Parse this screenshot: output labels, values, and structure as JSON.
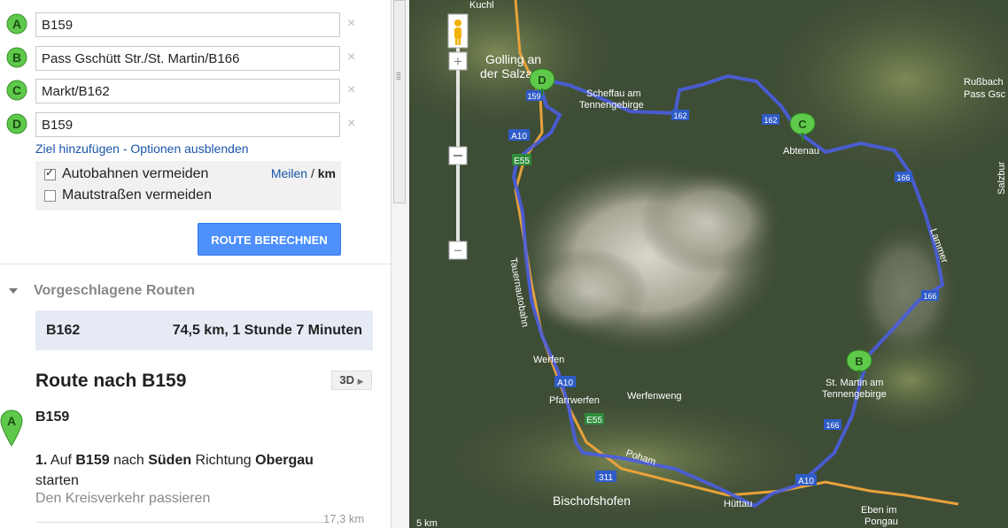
{
  "waypoints": [
    {
      "marker": "A",
      "value": "B159",
      "color": "#5ec94a"
    },
    {
      "marker": "B",
      "value": "Pass Gschütt Str./St. Martin/B166",
      "color": "#5ec94a"
    },
    {
      "marker": "C",
      "value": "Markt/B162",
      "color": "#5ec94a"
    },
    {
      "marker": "D",
      "value": "B159",
      "color": "#5ec94a"
    }
  ],
  "remove_glyph": "×",
  "links": {
    "add_destination": "Ziel hinzufügen",
    "separator": " - ",
    "hide_options": "Optionen ausblenden"
  },
  "options": {
    "avoid_highways": {
      "label": "Autobahnen vermeiden",
      "checked": true
    },
    "avoid_tolls": {
      "label": "Mautstraßen vermeiden",
      "checked": false
    },
    "units": {
      "miles": "Meilen",
      "separator": " / ",
      "km": "km"
    }
  },
  "route_button": "ROUTE BERECHNEN",
  "suggested": {
    "heading": "Vorgeschlagene Routen",
    "route_name": "B162",
    "route_info": "74,5 km, 1 Stunde 7 Minuten"
  },
  "directions": {
    "title": "Route nach B159",
    "btn_3d": "3D",
    "start_marker": "A",
    "start_label": "B159",
    "step_number": "1.",
    "step_parts": [
      "Auf ",
      "B159",
      " nach ",
      "Süden",
      " Richtung ",
      "Obergau",
      " starten"
    ],
    "step_note": "Den Kreisverkehr passieren",
    "step_distance": "17,3 km"
  },
  "map": {
    "labels": {
      "kuchl": "Kuchl",
      "golling_1": "Golling an",
      "golling_2": "der Salzach",
      "scheffau_1": "Scheffau am",
      "scheffau_2": "Tennengebirge",
      "abtenau": "Abtenau",
      "russbach_1": "Rußbach",
      "russbach_2": "Pass Gsc",
      "salzburg": "Salzbur",
      "werfen": "Werfen",
      "werfenweng": "Werfenweng",
      "pfarrwerfen": "Pfarrwerfen",
      "stmartin_1": "St. Martin am",
      "stmartin_2": "Tennengebirge",
      "bischofshofen": "Bischofshofen",
      "huttau": "Hüttau",
      "eben_1": "Eben im",
      "eben_2": "Pongau",
      "poham": "Poham",
      "tauernautobahn": "Tauernautobahn",
      "lammer": "Lammer"
    },
    "shields": {
      "a10": "A10",
      "e55": "E55",
      "b159": "159",
      "b162": "162",
      "b166": "166",
      "b311": "311"
    },
    "markers": {
      "b": "B",
      "c": "C",
      "d": "D"
    },
    "zoom_in": "+",
    "zoom_out": "−",
    "scale_label": "5 km",
    "route_color": "#4a5de0"
  }
}
